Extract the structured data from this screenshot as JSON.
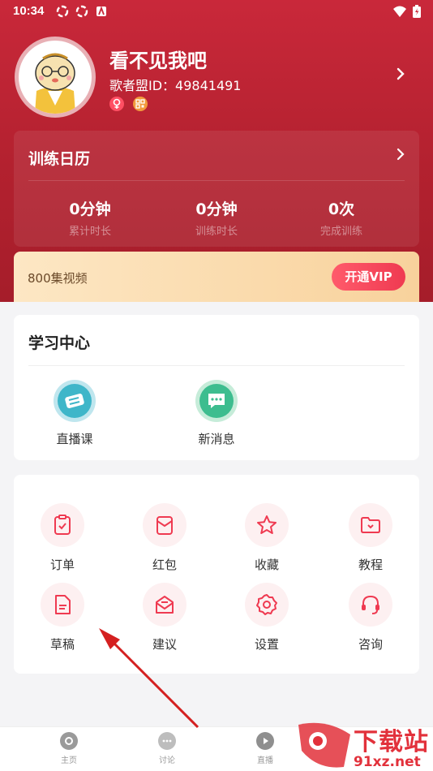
{
  "status_bar": {
    "time": "10:34"
  },
  "profile": {
    "name": "看不见我吧",
    "id_label": "歌者盟ID：",
    "id_value": "49841491"
  },
  "calendar": {
    "title": "训练日历",
    "stats": [
      {
        "value": "0分钟",
        "label": "累计时长"
      },
      {
        "value": "0分钟",
        "label": "训练时长"
      },
      {
        "value": "0次",
        "label": "完成训练"
      }
    ]
  },
  "vip": {
    "text": "800集视频",
    "button": "开通VIP"
  },
  "learning_center": {
    "title": "学习中心",
    "items": [
      {
        "label": "直播课",
        "icon": "ticket-icon"
      },
      {
        "label": "新消息",
        "icon": "message-icon"
      }
    ]
  },
  "tools": {
    "items": [
      {
        "label": "订单",
        "icon": "clipboard-icon"
      },
      {
        "label": "红包",
        "icon": "red-envelope-icon"
      },
      {
        "label": "收藏",
        "icon": "star-icon"
      },
      {
        "label": "教程",
        "icon": "folder-icon"
      },
      {
        "label": "草稿",
        "icon": "document-icon"
      },
      {
        "label": "建议",
        "icon": "mail-icon"
      },
      {
        "label": "设置",
        "icon": "gear-icon"
      },
      {
        "label": "咨询",
        "icon": "headset-icon"
      }
    ]
  },
  "tab_bar": {
    "items": [
      {
        "label": "主页",
        "icon": "home-icon"
      },
      {
        "label": "讨论",
        "icon": "chat-icon"
      },
      {
        "label": "直播",
        "icon": "play-icon"
      }
    ]
  },
  "watermark": {
    "text_top": "下载站",
    "text_bottom": "91xz.net"
  },
  "colors": {
    "header_red": "#c9283a",
    "accent": "#ef3a51",
    "vip_gold": "#f8d29c",
    "teal": "#3fb6c9",
    "green": "#3dbd8f"
  }
}
